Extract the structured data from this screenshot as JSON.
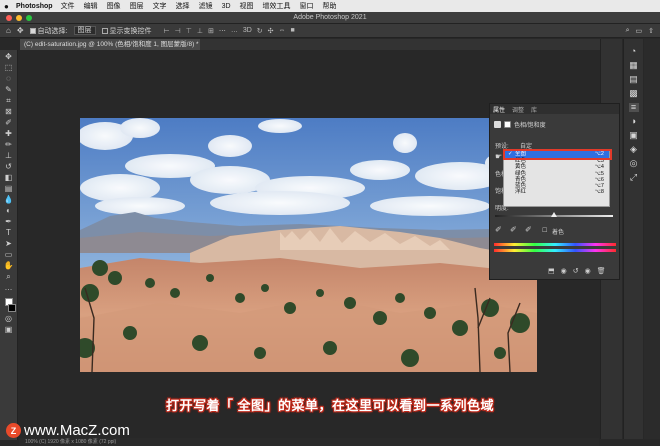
{
  "menubar": {
    "app": "Photoshop",
    "items": [
      "文件",
      "编辑",
      "图像",
      "图层",
      "文字",
      "选择",
      "滤镜",
      "3D",
      "视图",
      "增效工具",
      "窗口",
      "帮助"
    ]
  },
  "window": {
    "title": "Adobe Photoshop 2021"
  },
  "options": {
    "auto_select_label": "自动选择:",
    "auto_select_value": "图层",
    "transform_label": "显示变换控件"
  },
  "document": {
    "tab": "(C) edit-saturation.jpg @ 100% (色相/饱和度 1, 图层蒙版/8) *",
    "status": "100%   (C) 1920 像素 x 1080 像素 (72 ppi)"
  },
  "properties": {
    "tabs": [
      "属性",
      "调整",
      "库"
    ],
    "title": "色相/饱和度",
    "preset_label": "预设:",
    "preset_value": "自定",
    "hue_label": "色相:",
    "sat_label": "饱和度:",
    "light_label": "明度:",
    "colorize_label": "着色"
  },
  "dropdown": {
    "items": [
      {
        "label": "全图",
        "shortcut": "⌥2",
        "selected": true
      },
      {
        "label": "红色",
        "shortcut": "⌥3",
        "selected": false
      },
      {
        "label": "黄色",
        "shortcut": "⌥4",
        "selected": false
      },
      {
        "label": "绿色",
        "shortcut": "⌥5",
        "selected": false
      },
      {
        "label": "青色",
        "shortcut": "⌥6",
        "selected": false
      },
      {
        "label": "蓝色",
        "shortcut": "⌥7",
        "selected": false
      },
      {
        "label": "洋红",
        "shortcut": "⌥8",
        "selected": false
      }
    ]
  },
  "caption": "打开写着「 全图」的菜单，在这里可以看到一系列色域",
  "watermark": {
    "text": "www.MacZ.com",
    "logo": "Z"
  },
  "colors": {
    "accent": "#2f6fe0",
    "highlight": "#e23a2a"
  }
}
